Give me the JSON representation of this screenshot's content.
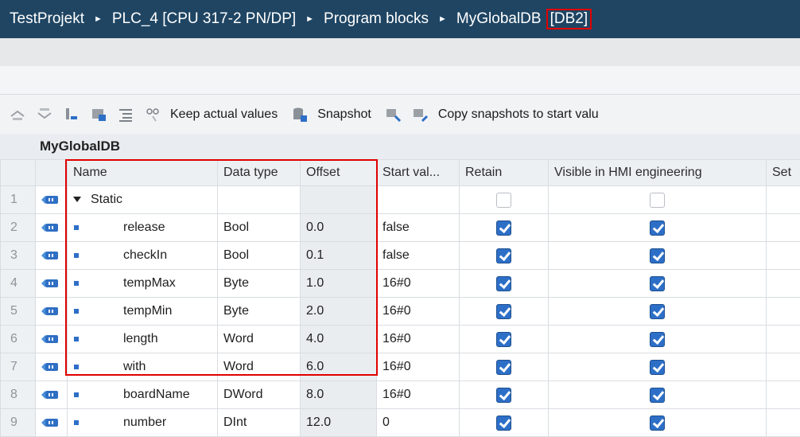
{
  "breadcrumb": {
    "items": [
      "TestProjekt",
      "PLC_4 [CPU 317-2 PN/DP]",
      "Program blocks",
      "MyGlobalDB"
    ],
    "highlight": "[DB2]",
    "separator": "►"
  },
  "toolbar": {
    "keep_actual_values_label": "Keep actual values",
    "snapshot_label": "Snapshot",
    "copy_snapshots_label": "Copy snapshots to start valu"
  },
  "db_name": "MyGlobalDB",
  "columns": {
    "name": "Name",
    "data_type": "Data type",
    "offset": "Offset",
    "start_value": "Start val...",
    "retain": "Retain",
    "visible_hmi": "Visible in HMI engineering",
    "setpoint": "Set"
  },
  "rows": [
    {
      "num": "1",
      "name": "Static",
      "type": "",
      "offset": "",
      "start": "",
      "retain": false,
      "visible": false
    },
    {
      "num": "2",
      "name": "release",
      "type": "Bool",
      "offset": "0.0",
      "start": "false",
      "retain": true,
      "visible": true
    },
    {
      "num": "3",
      "name": "checkIn",
      "type": "Bool",
      "offset": "0.1",
      "start": "false",
      "retain": true,
      "visible": true
    },
    {
      "num": "4",
      "name": "tempMax",
      "type": "Byte",
      "offset": "1.0",
      "start": "16#0",
      "retain": true,
      "visible": true
    },
    {
      "num": "5",
      "name": "tempMin",
      "type": "Byte",
      "offset": "2.0",
      "start": "16#0",
      "retain": true,
      "visible": true
    },
    {
      "num": "6",
      "name": "length",
      "type": "Word",
      "offset": "4.0",
      "start": "16#0",
      "retain": true,
      "visible": true
    },
    {
      "num": "7",
      "name": "with",
      "type": "Word",
      "offset": "6.0",
      "start": "16#0",
      "retain": true,
      "visible": true
    },
    {
      "num": "8",
      "name": "boardName",
      "type": "DWord",
      "offset": "8.0",
      "start": "16#0",
      "retain": true,
      "visible": true
    },
    {
      "num": "9",
      "name": "number",
      "type": "DInt",
      "offset": "12.0",
      "start": "0",
      "retain": true,
      "visible": true
    }
  ],
  "colors": {
    "title_bg": "#1f4563",
    "highlight_red": "#e00000",
    "checkbox_blue": "#2d6fc7"
  }
}
